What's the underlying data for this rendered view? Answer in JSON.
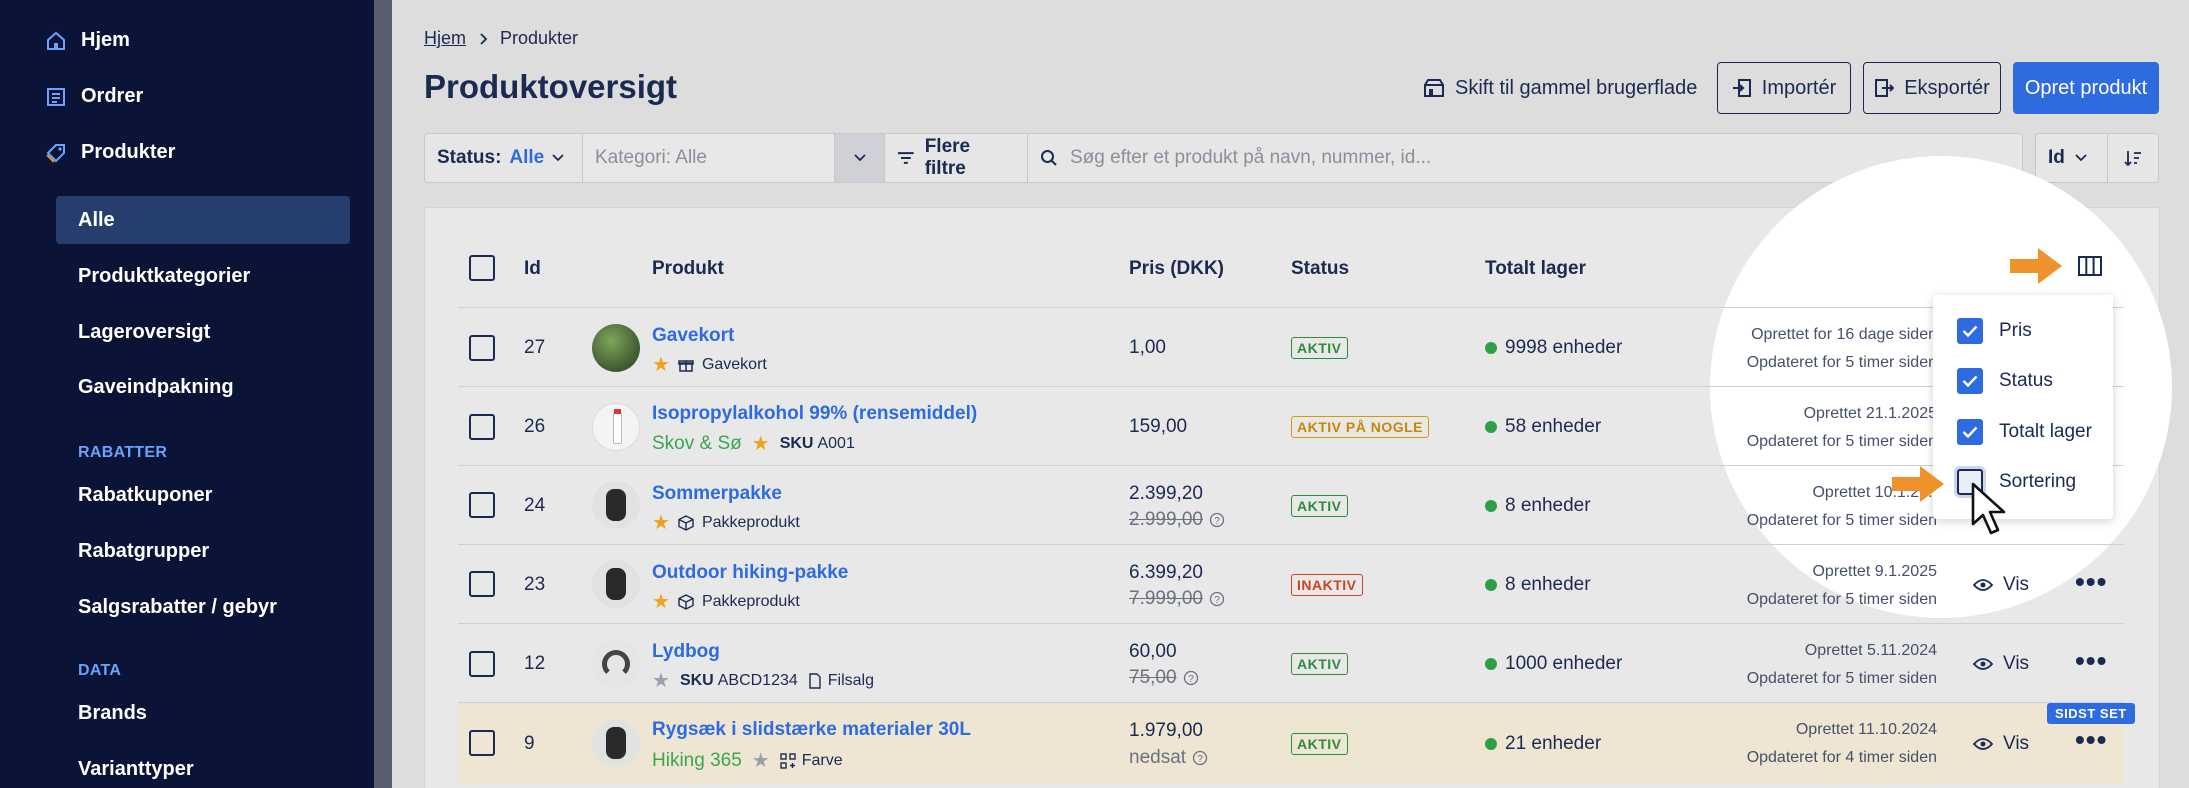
{
  "sidebar": {
    "items": [
      {
        "label": "Hjem"
      },
      {
        "label": "Ordrer"
      },
      {
        "label": "Produkter"
      }
    ],
    "sub": [
      {
        "label": "Alle"
      },
      {
        "label": "Produktkategorier"
      },
      {
        "label": "Lageroversigt"
      },
      {
        "label": "Gaveindpakning"
      }
    ],
    "sections": [
      {
        "label": "RABATTER"
      },
      {
        "label": "DATA"
      }
    ],
    "rabatter": [
      {
        "label": "Rabatkuponer"
      },
      {
        "label": "Rabatgrupper"
      },
      {
        "label": "Salgsrabatter / gebyr"
      }
    ],
    "data": [
      {
        "label": "Brands"
      },
      {
        "label": "Varianttyper"
      }
    ]
  },
  "breadcrumb": {
    "home": "Hjem",
    "current": "Produkter"
  },
  "page_title": "Produktoversigt",
  "actions": {
    "legacy": "Skift til gammel brugerflade",
    "import": "Importér",
    "export": "Eksportér",
    "create": "Opret produkt"
  },
  "filters": {
    "status_label": "Status:",
    "status_value": "Alle",
    "category_placeholder": "Kategori: Alle",
    "more": "Flere filtre",
    "search_placeholder": "Søg efter et produkt på navn, nummer, id...",
    "sort": "Id"
  },
  "table": {
    "headers": {
      "id": "Id",
      "product": "Produkt",
      "price": "Pris (DKK)",
      "status": "Status",
      "stock": "Totalt lager"
    },
    "view_label": "Vis",
    "last_seen": "SIDST SET",
    "rows": [
      {
        "id": "27",
        "name": "Gavekort",
        "brand": "",
        "sku_label": "",
        "sku": "",
        "type": "Gavekort",
        "price": "1,00",
        "old_price": "",
        "status": "AKTIV",
        "stock": "9998 enheder",
        "created": "Oprettet for 16 dage siden",
        "updated": "Opdateret for 5 timer siden"
      },
      {
        "id": "26",
        "name": "Isopropylalkohol 99% (rensemiddel)",
        "brand": "Skov & Sø",
        "sku_label": "SKU",
        "sku": "A001",
        "type": "",
        "price": "159,00",
        "old_price": "",
        "status": "AKTIV PÅ NOGLE",
        "stock": "58 enheder",
        "created": "Oprettet 21.1.2025",
        "updated": "Opdateret for 5 timer siden"
      },
      {
        "id": "24",
        "name": "Sommerpakke",
        "brand": "",
        "sku_label": "",
        "sku": "",
        "type": "Pakkeprodukt",
        "price": "2.399,20",
        "old_price": "2.999,00",
        "status": "AKTIV",
        "stock": "8 enheder",
        "created": "Oprettet 10.1.20..",
        "updated": "Opdateret for 5 timer siden"
      },
      {
        "id": "23",
        "name": "Outdoor hiking-pakke",
        "brand": "",
        "sku_label": "",
        "sku": "",
        "type": "Pakkeprodukt",
        "price": "6.399,20",
        "old_price": "7.999,00",
        "status": "INAKTIV",
        "stock": "8 enheder",
        "created": "Oprettet 9.1.2025",
        "updated": "Opdateret for 5 timer siden"
      },
      {
        "id": "12",
        "name": "Lydbog",
        "brand": "",
        "sku_label": "SKU",
        "sku": "ABCD1234",
        "type": "Filsalg",
        "price": "60,00",
        "old_price": "75,00",
        "status": "AKTIV",
        "stock": "1000 enheder",
        "created": "Oprettet 5.11.2024",
        "updated": "Opdateret for 5 timer siden"
      },
      {
        "id": "9",
        "name": "Rygsæk i slidstærke materialer 30L",
        "brand": "Hiking 365",
        "sku_label": "",
        "sku": "",
        "type": "Farve",
        "price": "1.979,00",
        "old_price": "nedsat",
        "status": "AKTIV",
        "stock": "21 enheder",
        "created": "Oprettet 11.10.2024",
        "updated": "Opdateret for 4 timer siden"
      }
    ]
  },
  "column_menu": {
    "items": [
      {
        "label": "Pris",
        "checked": true
      },
      {
        "label": "Status",
        "checked": true
      },
      {
        "label": "Totalt lager",
        "checked": true
      },
      {
        "label": "Sortering",
        "checked": false
      }
    ]
  },
  "colors": {
    "sidebar": "#0b1437",
    "primary": "#2f6be0",
    "accent": "#f0922b",
    "highlight_row": "#eee6d3"
  },
  "icons": [
    "home-icon",
    "orders-icon",
    "tag-icon",
    "arrow-right-icon",
    "columns-icon",
    "cursor-icon",
    "eye-icon",
    "more-icon",
    "search-icon",
    "filter-icon",
    "sort-icon",
    "import-icon",
    "export-icon",
    "shop-icon",
    "star-icon",
    "gift-icon",
    "box-icon",
    "file-icon",
    "variant-icon",
    "help-icon"
  ]
}
